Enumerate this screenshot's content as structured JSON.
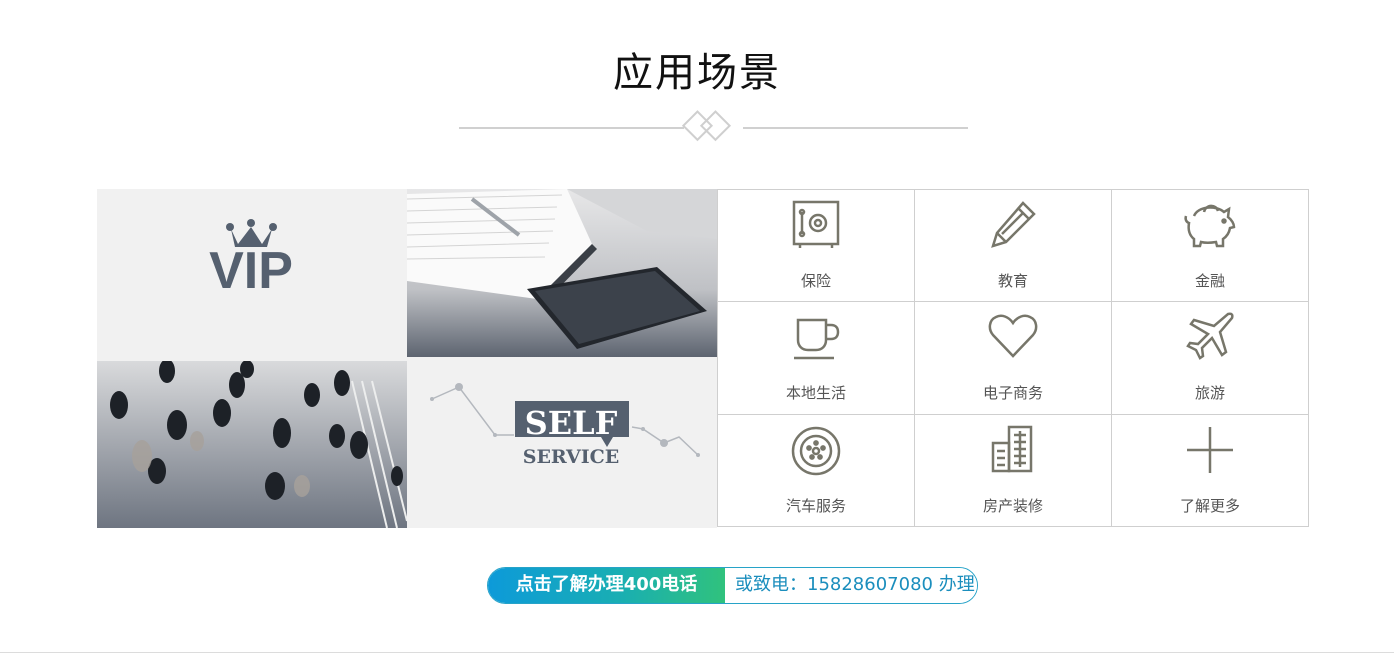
{
  "section": {
    "title": "应用场景"
  },
  "tiles": {
    "vip_text": "VIP",
    "self_text": "SELF",
    "service_text": "SERVICE"
  },
  "scenarios": [
    {
      "label": "保险",
      "icon": "safe-icon"
    },
    {
      "label": "教育",
      "icon": "pencil-icon"
    },
    {
      "label": "金融",
      "icon": "piggy-bank-icon"
    },
    {
      "label": "本地生活",
      "icon": "coffee-cup-icon"
    },
    {
      "label": "电子商务",
      "icon": "heart-icon"
    },
    {
      "label": "旅游",
      "icon": "airplane-icon"
    },
    {
      "label": "汽车服务",
      "icon": "wheel-icon"
    },
    {
      "label": "房产装修",
      "icon": "building-icon"
    },
    {
      "label": "了解更多",
      "icon": "plus-icon"
    }
  ],
  "cta": {
    "button_label": "点击了解办理400电话",
    "phone_text": "或致电：15828607080 办理"
  },
  "colors": {
    "icon": "#77766a",
    "tile_bg": "#f1f1f1",
    "logo_slate": "#55606f",
    "cta_gradient_start": "#0d9ad9",
    "cta_gradient_end": "#30c27d",
    "cta_text": "#1b8ebd"
  }
}
